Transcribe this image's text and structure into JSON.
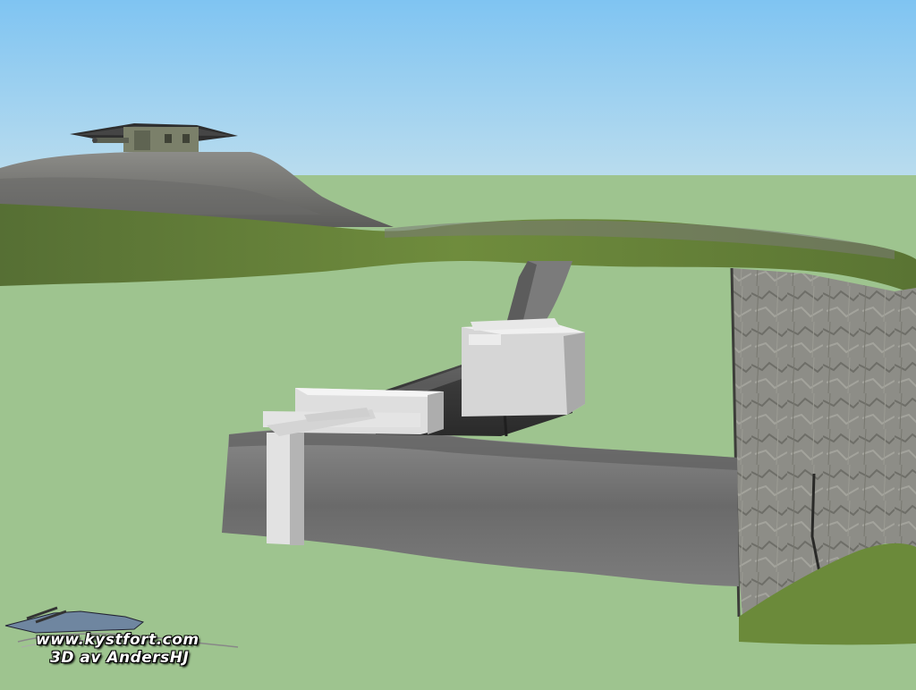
{
  "scene": {
    "description_label": "",
    "colors": {
      "sky_top": "#7fc4f2",
      "sky_bottom": "#b8dcf0",
      "ground": "#9ec48f",
      "grass_dark": "#4f6b2e",
      "grass_light": "#7a9a44",
      "concrete": "#d8d8d8",
      "concrete_shadow": "#a8a8a8",
      "rock_gray": "#6e6e6e",
      "tunnel_dark": "#333333",
      "cliff_stone": "#8a8a84"
    }
  },
  "watermark": {
    "url": "www.kystfort.com",
    "credit": "3D av AndersHJ",
    "icon": "battleship-logo-icon"
  }
}
